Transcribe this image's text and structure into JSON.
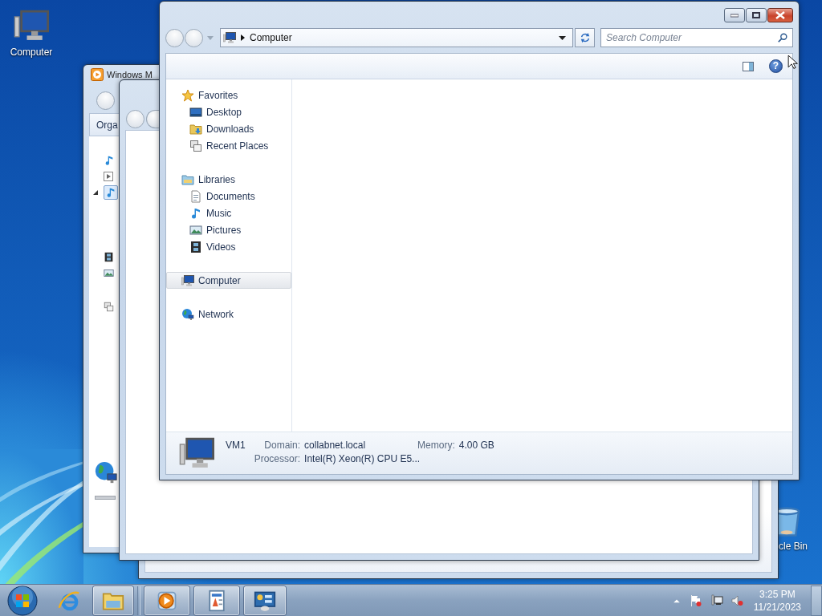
{
  "desktop_icons": [
    {
      "label": "Computer"
    },
    {
      "label": "cle Bin"
    }
  ],
  "background_window": {
    "title": "Windows M",
    "toolbar_button": "Orga"
  },
  "window": {
    "address": "Computer",
    "search": {
      "placeholder": "Search Computer"
    },
    "help_button": "?",
    "nav": [
      {
        "label": "Favorites",
        "selected": false,
        "children": [
          {
            "label": "Desktop",
            "selected": false
          },
          {
            "label": "Downloads",
            "selected": false
          },
          {
            "label": "Recent Places",
            "selected": false
          }
        ]
      },
      {
        "label": "Libraries",
        "selected": false,
        "children": [
          {
            "label": "Documents",
            "selected": false
          },
          {
            "label": "Music",
            "selected": false
          },
          {
            "label": "Pictures",
            "selected": false
          },
          {
            "label": "Videos",
            "selected": false
          }
        ]
      },
      {
        "label": "Computer",
        "selected": true
      },
      {
        "label": "Network",
        "selected": false
      }
    ],
    "details": {
      "name": "VM1",
      "fields": [
        {
          "label": "Domain:",
          "value": "collabnet.local"
        },
        {
          "label": "Memory:",
          "value": "4.00 GB"
        },
        {
          "label": "Processor:",
          "value": "Intel(R) Xeon(R) CPU E5..."
        }
      ]
    }
  },
  "taskbar": {
    "items": [
      {
        "running": false
      },
      {
        "running": true
      },
      {
        "running": true
      },
      {
        "running": true
      },
      {
        "running": true
      }
    ],
    "clock": {
      "time": "3:25 PM",
      "date": "11/21/2023"
    }
  }
}
